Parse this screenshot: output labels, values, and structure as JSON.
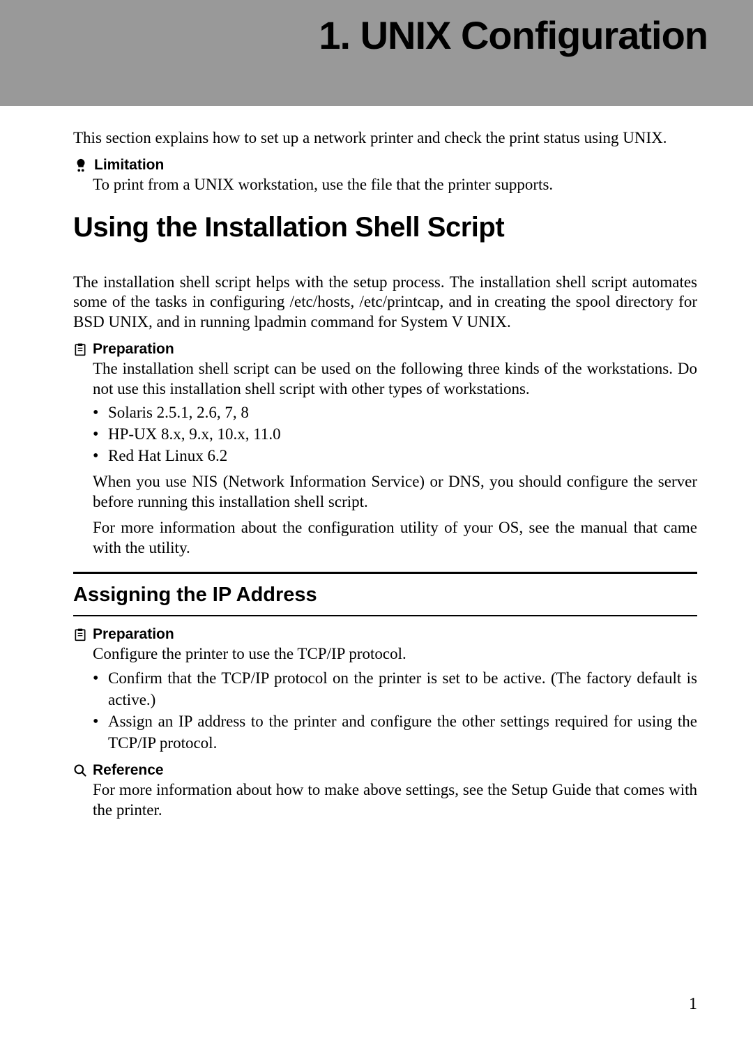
{
  "header": {
    "chapter_title": "1. UNIX Configuration"
  },
  "intro": "This section explains how to set up a network printer and check the print status using UNIX.",
  "limitation": {
    "label": "Limitation",
    "text": "To print from a UNIX workstation, use the file that the printer supports."
  },
  "section1": {
    "title": "Using the Installation Shell Script",
    "para": "The installation shell script helps with the setup process. The installation shell script automates some of the tasks in configuring /etc/hosts, /etc/printcap, and in creating the spool directory for BSD UNIX, and in running lpadmin command for System V UNIX."
  },
  "prep1": {
    "label": "Preparation",
    "intro": "The installation shell script can be used on the following three kinds of the workstations. Do not use this installation shell script with other types of workstations.",
    "items": [
      "Solaris 2.5.1, 2.6, 7, 8",
      "HP-UX 8.x, 9.x, 10.x, 11.0",
      "Red Hat Linux 6.2"
    ],
    "after1": "When you use NIS (Network Information Service) or DNS, you should configure the server before running this installation shell script.",
    "after2": "For more information about the configuration utility of your OS, see the manual that came with the utility."
  },
  "subsection": {
    "title": "Assigning the IP Address"
  },
  "prep2": {
    "label": "Preparation",
    "intro": "Configure the printer to use the TCP/IP protocol.",
    "items": [
      "Confirm that the TCP/IP protocol on the printer is set to be active. (The factory default is active.)",
      "Assign an IP address to the printer and configure the other settings required for using the TCP/IP protocol."
    ]
  },
  "reference": {
    "label": "Reference",
    "text": "For more information about how to make above settings, see the Setup Guide that comes with the printer."
  },
  "page_number": "1"
}
